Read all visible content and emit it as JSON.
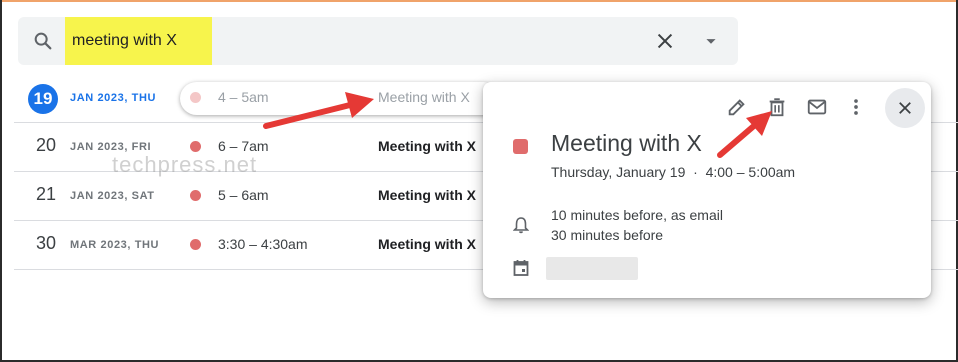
{
  "search": {
    "value": "meeting with X",
    "icons": {
      "search": "search-icon",
      "clear": "close-icon",
      "options": "chevron-down-icon"
    }
  },
  "events": [
    {
      "day": "19",
      "meta": "JAN 2023, THU",
      "time": "4 – 5am",
      "title": "Meeting with X",
      "today": true
    },
    {
      "day": "20",
      "meta": "JAN 2023, FRI",
      "time": "6 – 7am",
      "title": "Meeting with X"
    },
    {
      "day": "21",
      "meta": "JAN 2023, SAT",
      "time": "5 – 6am",
      "title": "Meeting with X"
    },
    {
      "day": "30",
      "meta": "MAR 2023, THU",
      "time": "3:30 – 4:30am",
      "title": "Meeting with X"
    }
  ],
  "watermark": "techpress.net",
  "popup": {
    "title": "Meeting with X",
    "date_line": "Thursday, January 19  ·  4:00 – 5:00am",
    "notifications": [
      "10 minutes before, as email",
      "30 minutes before"
    ],
    "toolbar_icons": [
      "edit-icon",
      "delete-icon",
      "email-icon",
      "more-vert-icon",
      "close-icon"
    ]
  },
  "colors": {
    "accent_blue": "#1a73e8",
    "event_color": "#e06c6c",
    "highlight": "#f7f44c",
    "annotation_arrow": "#e53935"
  }
}
